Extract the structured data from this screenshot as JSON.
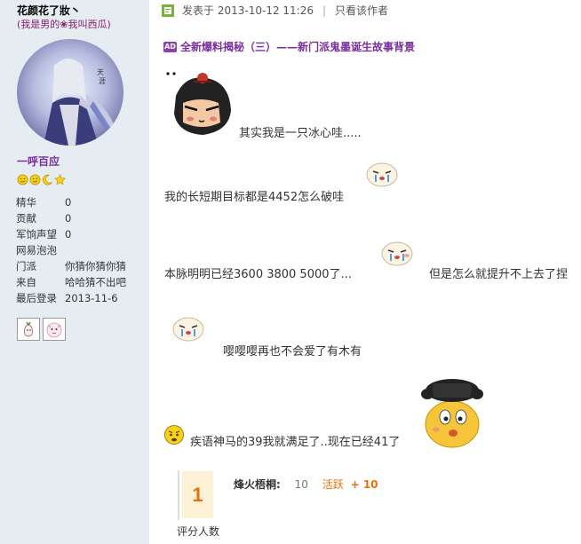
{
  "author": {
    "username": "花颜花了妝丶",
    "title": "(我是男的❀我叫西瓜)",
    "rank": "一呼百应",
    "stats": [
      {
        "label": "精华",
        "value": "0"
      },
      {
        "label": "贡献",
        "value": "0"
      },
      {
        "label": "军饷声望",
        "value": "0"
      },
      {
        "label": "网易泡泡",
        "value": ""
      },
      {
        "label": "门派",
        "value": "你猜你猜你猜"
      },
      {
        "label": "来自",
        "value": "哈哈猜不出吧"
      },
      {
        "label": "最后登录",
        "value": "2013-11-6"
      }
    ]
  },
  "post": {
    "posted_prefix": "发表于",
    "posted_time": "2013-10-12 11:26",
    "separator": "|",
    "author_only": "只看该作者",
    "ad_icon": "AD",
    "ad_text": "全新爆料揭秘（三）——新门派鬼墨诞生故事背景",
    "lines": [
      "其实我是一只冰心哇.....",
      "我的长短期目标都是4452怎么破哇",
      "本脉明明已经3600 3800 5000了...",
      "但是怎么就提升不上去了捏",
      "嘤嘤嘤再也不会爱了有木有",
      "疾语神马的39我就满足了..现在已经41了"
    ]
  },
  "rating": {
    "count": "1",
    "label": "评分人数",
    "rater": "烽火梧桐:",
    "score": "10",
    "category": "活跃",
    "plus": "+ 10"
  },
  "colors": {
    "sidebar_bg": "#e5edf2",
    "accent_purple": "#7a2f9c",
    "rating_orange": "#e8700b"
  }
}
